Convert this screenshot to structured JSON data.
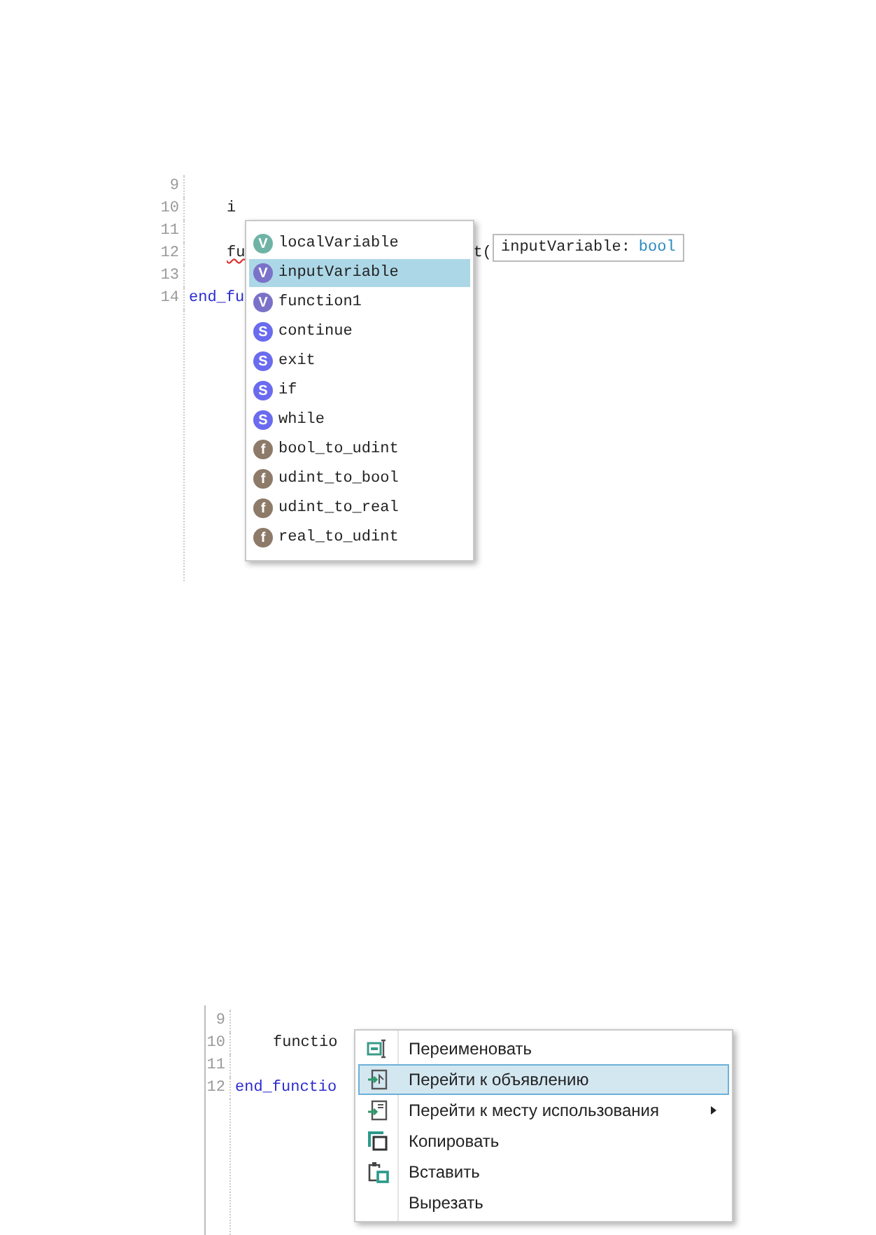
{
  "editors": [
    {
      "kind": "completion",
      "lines": [
        {
          "number": "9"
        },
        {
          "number": "10",
          "indented": true,
          "segments": [
            {
              "text": "i",
              "kind": "code",
              "error": false
            }
          ]
        },
        {
          "number": "11"
        },
        {
          "number": "12",
          "indented": true,
          "segments": [
            {
              "text": "fu",
              "kind": "code",
              "error": true
            },
            {
              "text": "t(",
              "kind": "code",
              "error": false
            }
          ]
        },
        {
          "number": "13"
        },
        {
          "number": "14",
          "indented": false,
          "segments": [
            {
              "text": "end_fu",
              "kind": "keyword",
              "error": false
            }
          ]
        }
      ],
      "completion": {
        "items": [
          {
            "label": "localVariable",
            "kind": "local",
            "badge": "V",
            "selected": false
          },
          {
            "label": "inputVariable",
            "kind": "input",
            "badge": "V",
            "selected": true
          },
          {
            "label": "function1",
            "kind": "input",
            "badge": "V",
            "selected": false
          },
          {
            "label": "continue",
            "kind": "statement",
            "badge": "S",
            "selected": false
          },
          {
            "label": "exit",
            "kind": "statement",
            "badge": "S",
            "selected": false
          },
          {
            "label": "if",
            "kind": "statement",
            "badge": "S",
            "selected": false
          },
          {
            "label": "while",
            "kind": "statement",
            "badge": "S",
            "selected": false
          },
          {
            "label": "bool_to_udint",
            "kind": "function",
            "badge": "f",
            "selected": false
          },
          {
            "label": "udint_to_bool",
            "kind": "function",
            "badge": "f",
            "selected": false
          },
          {
            "label": "udint_to_real",
            "kind": "function",
            "badge": "f",
            "selected": false
          },
          {
            "label": "real_to_udint",
            "kind": "function",
            "badge": "f",
            "selected": false
          }
        ],
        "tooltip": {
          "name": "inputVariable:",
          "type": "bool"
        }
      }
    },
    {
      "kind": "context",
      "lines": [
        {
          "number": "9"
        },
        {
          "number": "10",
          "indented": true,
          "segments": [
            {
              "text": "functio",
              "kind": "code",
              "error": false
            }
          ]
        },
        {
          "number": "11"
        },
        {
          "number": "12",
          "indented": false,
          "segments": [
            {
              "text": "end_functio",
              "kind": "keyword",
              "error": false
            }
          ]
        }
      ],
      "menu": {
        "items": [
          {
            "label": "Переименовать",
            "kind": "rename",
            "selected": false,
            "submenu": false
          },
          {
            "label": "Перейти к объявлению",
            "kind": "declaration",
            "selected": true,
            "submenu": false
          },
          {
            "label": "Перейти к месту использования",
            "kind": "usages",
            "selected": false,
            "submenu": true
          },
          {
            "label": "Копировать",
            "kind": "copy",
            "selected": false,
            "submenu": false
          },
          {
            "label": "Вставить",
            "kind": "paste",
            "selected": false,
            "submenu": false
          },
          {
            "label": "Вырезать",
            "kind": "plain",
            "selected": false,
            "submenu": false
          }
        ]
      }
    }
  ]
}
